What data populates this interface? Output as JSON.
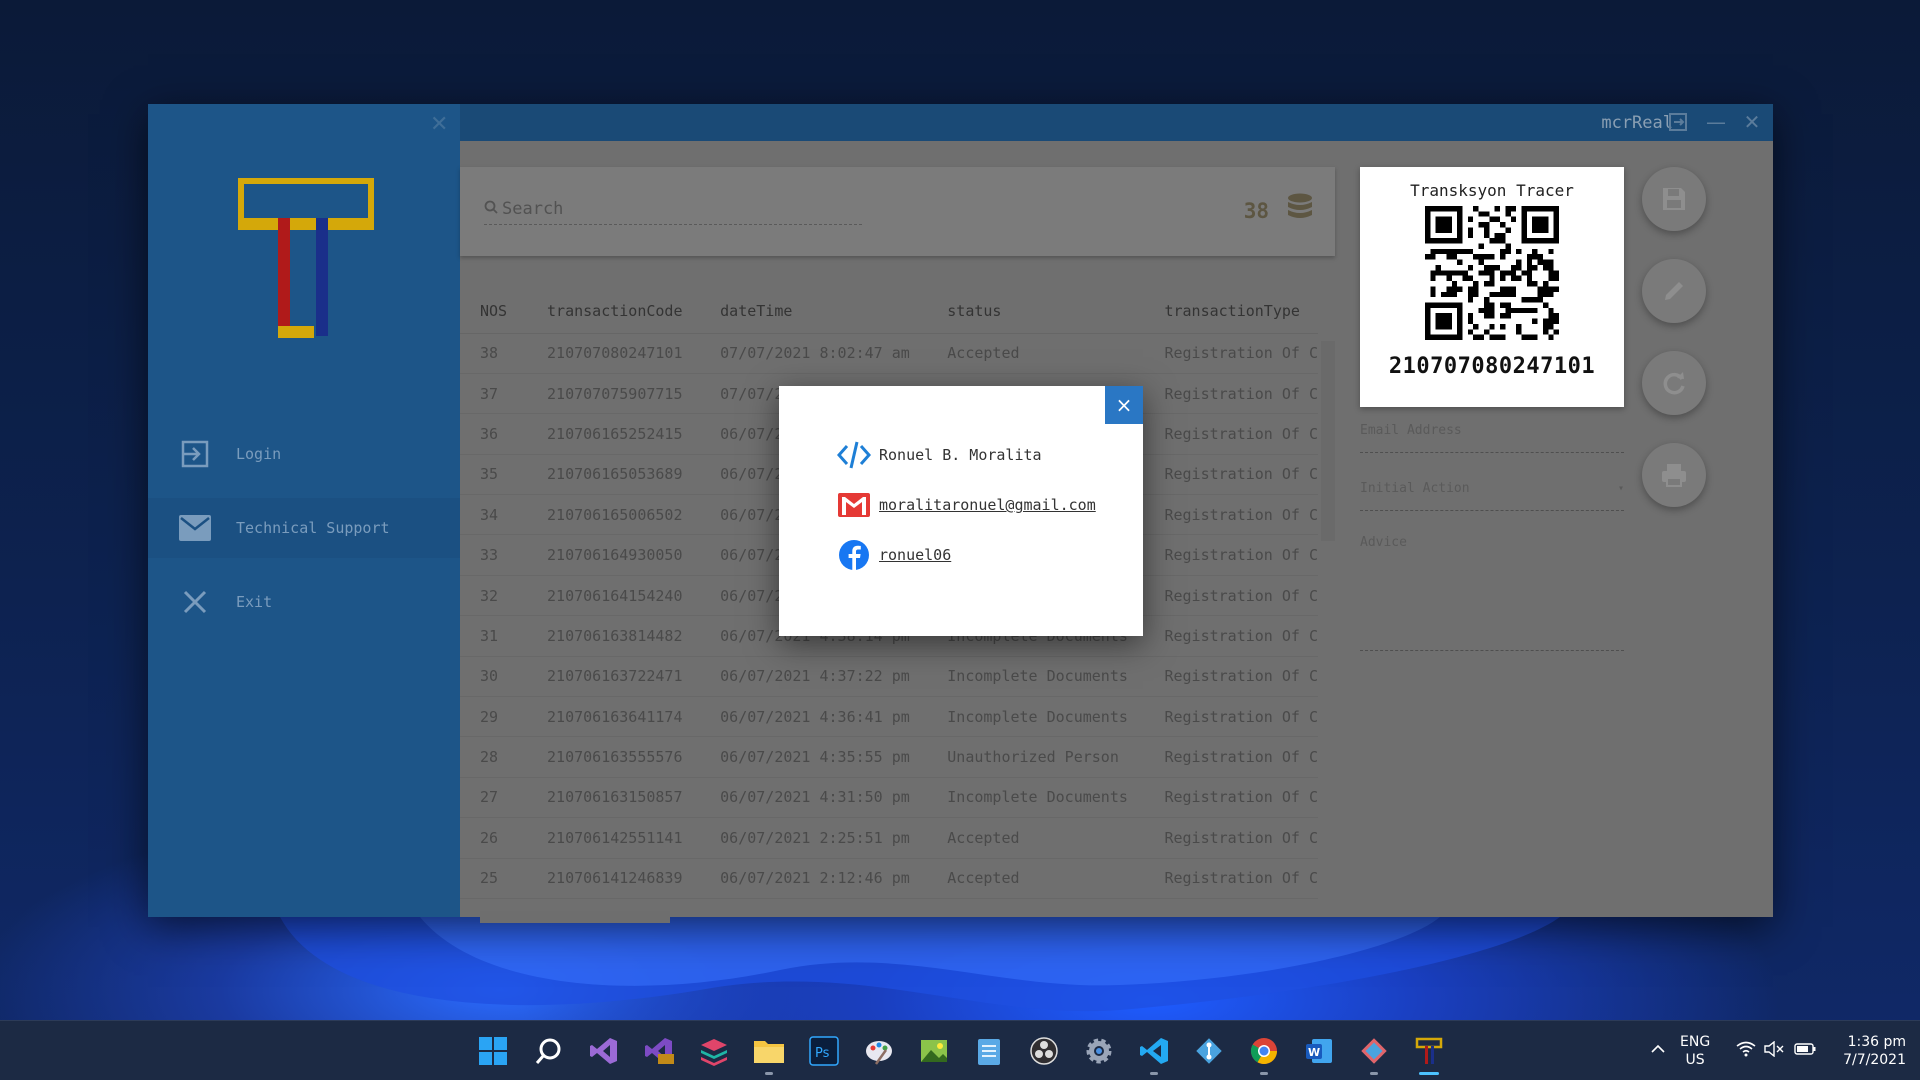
{
  "app": {
    "title": "mcrReal",
    "sidebar": {
      "items": [
        {
          "label": "Login",
          "icon": "login-icon"
        },
        {
          "label": "Technical Support",
          "icon": "mail-icon"
        },
        {
          "label": "Exit",
          "icon": "close-icon"
        }
      ]
    },
    "search": {
      "placeholder": "Search",
      "count": "38"
    },
    "table": {
      "columns": [
        "NOS",
        "transactionCode",
        "dateTime",
        "status",
        "transactionType"
      ],
      "rows": [
        [
          "38",
          "210707080247101",
          "07/07/2021 8:02:47 am",
          "Accepted",
          "Registration Of C"
        ],
        [
          "37",
          "210707075907715",
          "07/07/2",
          "",
          "Registration Of C"
        ],
        [
          "36",
          "210706165252415",
          "06/07/2",
          "",
          "Registration Of C"
        ],
        [
          "35",
          "210706165053689",
          "06/07/2",
          "",
          "Registration Of C"
        ],
        [
          "34",
          "210706165006502",
          "06/07/2",
          "",
          "Registration Of C"
        ],
        [
          "33",
          "210706164930050",
          "06/07/2",
          "",
          "Registration Of C"
        ],
        [
          "32",
          "210706164154240",
          "06/07/2",
          "",
          "Registration Of C"
        ],
        [
          "31",
          "210706163814482",
          "06/07/2021 4:38:14 pm",
          "Incomplete Documents",
          "Registration Of C"
        ],
        [
          "30",
          "210706163722471",
          "06/07/2021 4:37:22 pm",
          "Incomplete Documents",
          "Registration Of C"
        ],
        [
          "29",
          "210706163641174",
          "06/07/2021 4:36:41 pm",
          "Incomplete Documents",
          "Registration Of C"
        ],
        [
          "28",
          "210706163555576",
          "06/07/2021 4:35:55 pm",
          "Unauthorized Person",
          "Registration Of C"
        ],
        [
          "27",
          "210706163150857",
          "06/07/2021 4:31:50 pm",
          "Incomplete Documents",
          "Registration Of C"
        ],
        [
          "26",
          "210706142551141",
          "06/07/2021 2:25:51 pm",
          "Accepted",
          "Registration Of C"
        ],
        [
          "25",
          "210706141246839",
          "06/07/2021 2:12:46 pm",
          "Accepted",
          "Registration Of C"
        ]
      ]
    },
    "qr": {
      "title": "Transksyon Tracer",
      "code": "210707080247101"
    },
    "form": {
      "email_placeholder": "Email Address",
      "initial_action": "Initial Action",
      "advice_placeholder": "Advice"
    },
    "modal": {
      "name": "Ronuel B. Moralita",
      "email": "moralitaronuel@gmail.com",
      "facebook": "ronuel06",
      "close": "×"
    }
  },
  "taskbar": {
    "lang_1": "ENG",
    "lang_2": "US",
    "time": "1:36 pm",
    "date": "7/7/2021"
  },
  "colors": {
    "sidebar": "#1d5588",
    "accent": "#2a77c4",
    "logo_yellow": "#d4a80a",
    "logo_red": "#b01a1a",
    "logo_blue": "#1a2f8a"
  }
}
